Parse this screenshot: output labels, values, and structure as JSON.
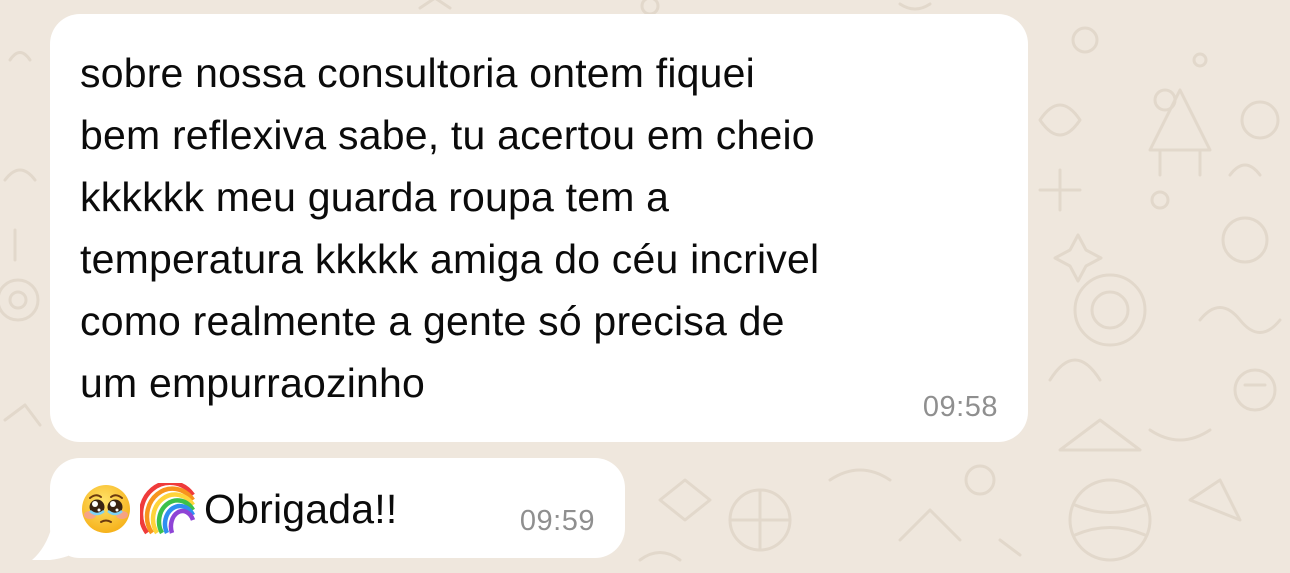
{
  "chat": {
    "messages": [
      {
        "text": "sobre nossa consultoria ontem fiquei\nbem reflexiva sabe, tu acertou em cheio\nkkkkkk meu guarda roupa tem a\ntemperatura kkkkk amiga do céu incrivel\ncomo realmente a gente só precisa de\num empurraozinho",
        "time": "09:58"
      },
      {
        "emojis": [
          "pleading-face-emoji",
          "rainbow-emoji"
        ],
        "text": "Obrigada!!",
        "time": "09:59"
      }
    ]
  },
  "colors": {
    "wallpaper": "#efe7dd",
    "bubble": "#ffffff",
    "text": "#0b0b0b",
    "timestamp": "#8f8f8f"
  }
}
